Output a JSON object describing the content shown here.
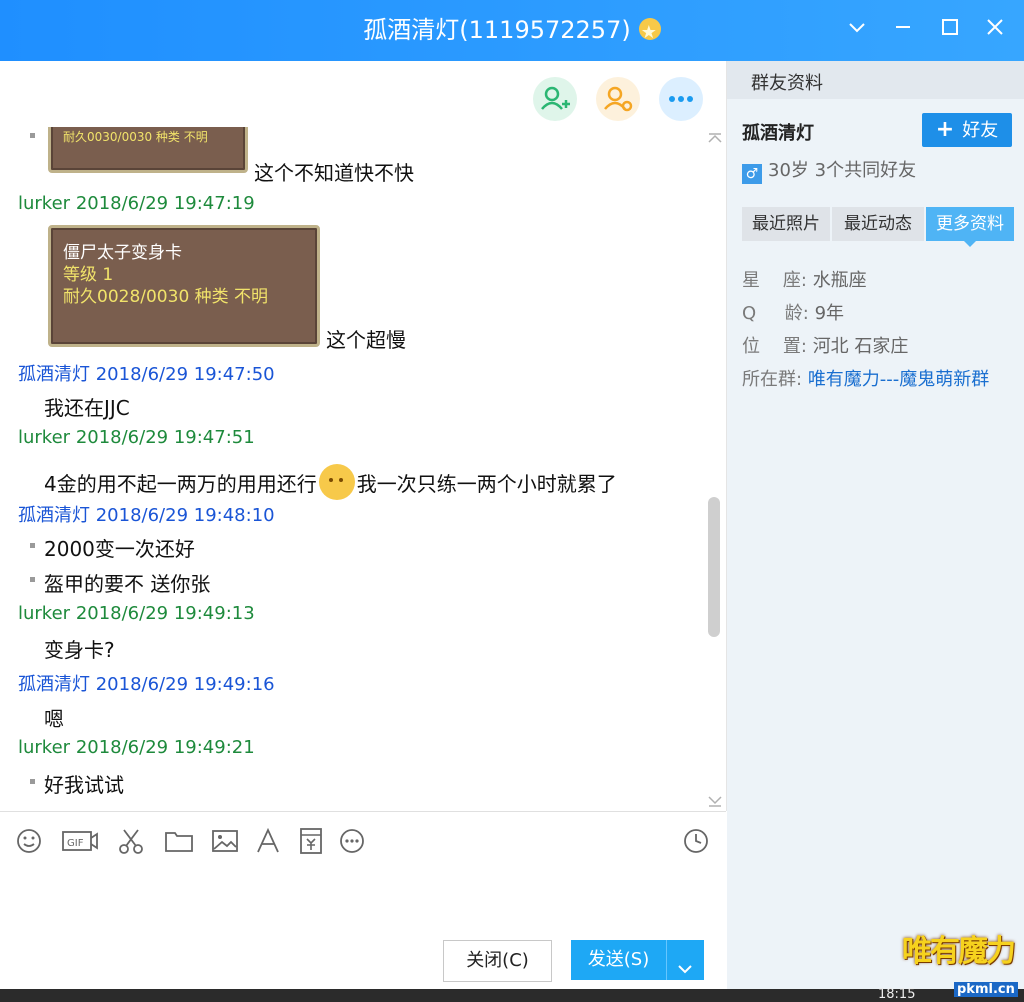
{
  "window": {
    "title": "孤酒清灯(1119572257)",
    "icons": [
      "chevron-down-icon",
      "minimize-icon",
      "maximize-icon",
      "close-icon"
    ]
  },
  "chat": {
    "actions": [
      {
        "name": "add-friend-icon",
        "color": "#2bb673"
      },
      {
        "name": "user-settings-icon",
        "color": "#f5a623"
      },
      {
        "name": "more-icon",
        "color": "#1a9bf0"
      }
    ],
    "messages": [
      {
        "type": "card_partial",
        "card_line": "耐久0030/0030  种类  不明",
        "text": "这个不知道快不快"
      },
      {
        "type": "meta",
        "sender": "lurker",
        "time": "2018/6/29 19:47:19"
      },
      {
        "type": "card",
        "lines": [
          "僵尸太子变身卡",
          "等级  1",
          "耐久0028/0030  种类  不明"
        ],
        "text": "这个超慢"
      },
      {
        "type": "meta",
        "sender": "孤酒清灯",
        "time": "2018/6/29 19:47:50"
      },
      {
        "type": "text",
        "text": "我还在JJC"
      },
      {
        "type": "meta",
        "sender": "lurker",
        "time": "2018/6/29 19:47:51"
      },
      {
        "type": "text_emoji",
        "before": "4金的用不起一两万的用用还行",
        "after": "我一次只练一两个小时就累了"
      },
      {
        "type": "meta",
        "sender": "孤酒清灯",
        "time": "2018/6/29 19:48:10"
      },
      {
        "type": "bullet",
        "text": "2000变一次还好"
      },
      {
        "type": "bullet",
        "text": "盔甲的要不 送你张"
      },
      {
        "type": "meta",
        "sender": "lurker",
        "time": "2018/6/29 19:49:13"
      },
      {
        "type": "text",
        "text": "变身卡?"
      },
      {
        "type": "meta",
        "sender": "孤酒清灯",
        "time": "2018/6/29 19:49:16"
      },
      {
        "type": "text",
        "text": "嗯"
      },
      {
        "type": "meta",
        "sender": "lurker",
        "time": "2018/6/29 19:49:21"
      },
      {
        "type": "bullet",
        "text": "好我试试"
      }
    ]
  },
  "toolbar": {
    "icons": [
      "emoji-icon",
      "gif-icon",
      "scissors-icon",
      "folder-icon",
      "image-icon",
      "font-icon",
      "red-packet-icon",
      "more-icon",
      "history-icon"
    ]
  },
  "buttons": {
    "close": "关闭(C)",
    "send": "发送(S)"
  },
  "profile": {
    "section": "群友资料",
    "name": "孤酒清灯",
    "add_friend": "好友",
    "stats": "30岁 3个共同好友",
    "tabs": [
      "最近照片",
      "最近动态",
      "更多资料"
    ],
    "active_tab": "更多资料",
    "fields": [
      {
        "label": "星    座:",
        "value": "水瓶座"
      },
      {
        "label": "Q     龄:",
        "value": "9年"
      },
      {
        "label": "位    置:",
        "value": "河北 石家庄"
      },
      {
        "label": "所在群:",
        "value": "唯有魔力---魔鬼萌新群"
      }
    ]
  },
  "taskbar": {
    "time": "18:15"
  },
  "watermark": {
    "text": "唯有魔力",
    "url": "pkml.cn"
  }
}
